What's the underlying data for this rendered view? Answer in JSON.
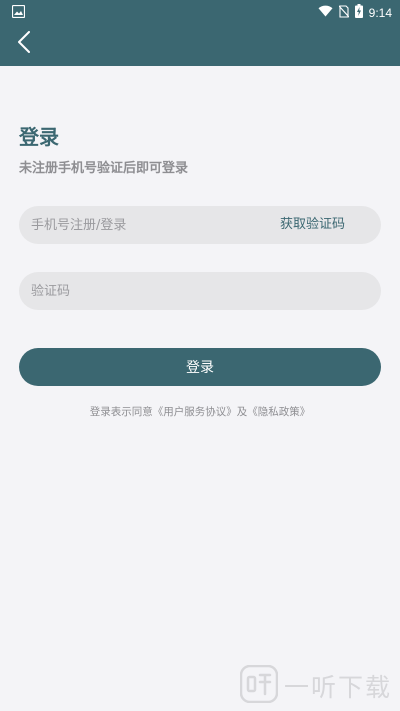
{
  "status_bar": {
    "time": "9:14"
  },
  "header": {
    "back_icon": "chevron-left-icon"
  },
  "page": {
    "title": "登录",
    "subtitle": "未注册手机号验证后即可登录"
  },
  "form": {
    "phone_placeholder": "手机号注册/登录",
    "get_code_label": "获取验证码",
    "code_placeholder": "验证码",
    "login_label": "登录"
  },
  "agreement": {
    "prefix": "登录表示同意",
    "user_agreement": "《用户服务协议》",
    "connector": "及",
    "privacy_policy": "《隐私政策》"
  },
  "watermark": {
    "text": "一听下载"
  },
  "colors": {
    "primary": "#3b6771",
    "background": "#f4f4f7",
    "field": "#e6e6e8"
  }
}
